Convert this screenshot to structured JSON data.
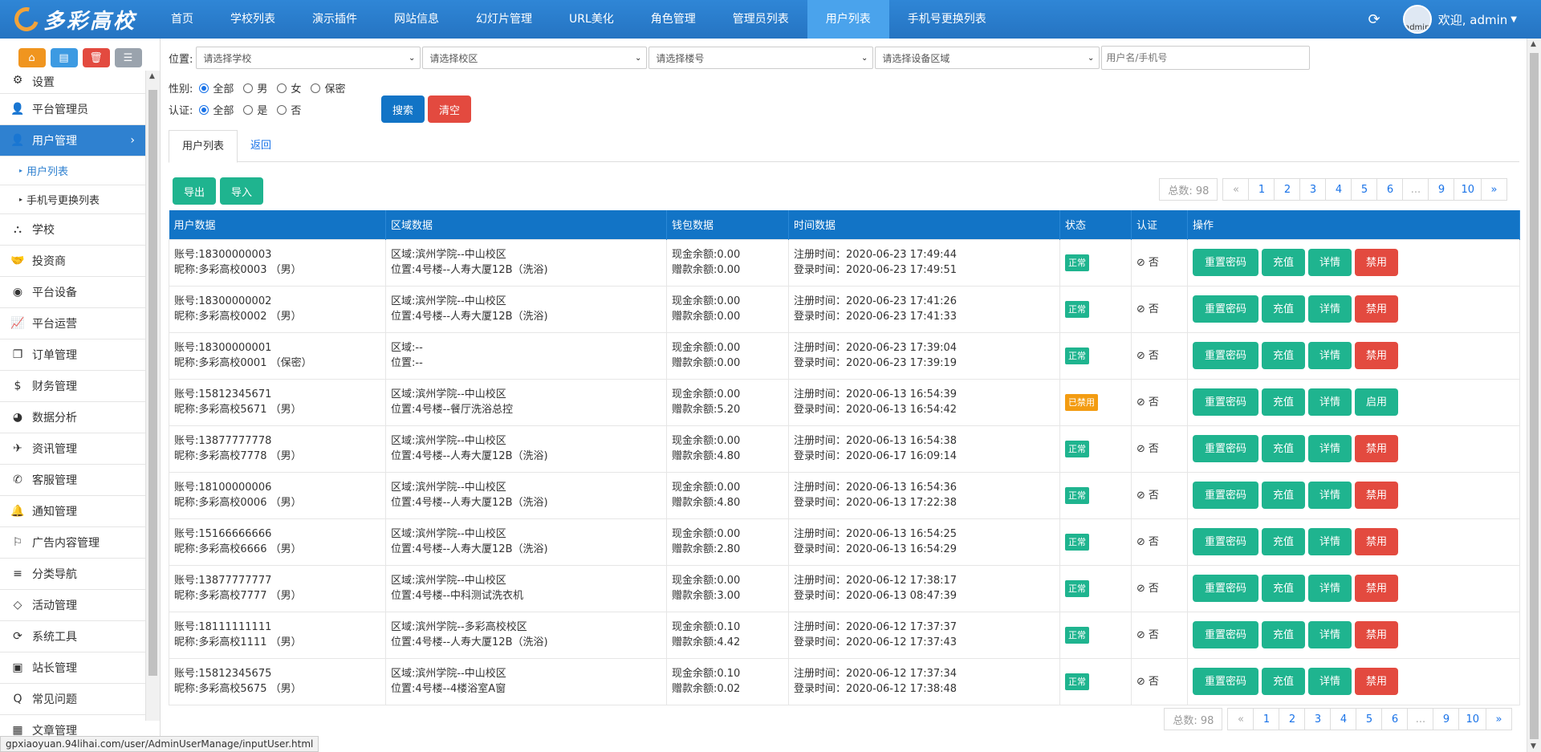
{
  "brand": {
    "name": "多彩高校"
  },
  "nav": [
    "首页",
    "学校列表",
    "演示插件",
    "网站信息",
    "幻灯片管理",
    "URL美化",
    "角色管理",
    "管理员列表",
    "用户列表",
    "手机号更换列表"
  ],
  "nav_active": 8,
  "user": {
    "avatar_alt": "admin",
    "greeting": "欢迎, admin"
  },
  "sidebar_tools": [
    {
      "icon": "home-icon",
      "glyph": "⌂",
      "color": "#f0951f"
    },
    {
      "icon": "file-icon",
      "glyph": "▤",
      "color": "#3c9ae2"
    },
    {
      "icon": "trash-icon",
      "glyph": "🗑",
      "color": "#e34a3f"
    },
    {
      "icon": "list-icon",
      "glyph": "☰",
      "color": "#9aa3ad"
    }
  ],
  "menu": [
    {
      "label": "设置",
      "icon": "gears-icon",
      "glyph": "⚙"
    },
    {
      "label": "平台管理员",
      "icon": "user-plus-icon",
      "glyph": "👤"
    },
    {
      "label": "用户管理",
      "icon": "user-icon",
      "glyph": "👤",
      "active": true
    },
    {
      "label": "用户列表",
      "sub": true,
      "active": true
    },
    {
      "label": "手机号更换列表",
      "sub": true
    },
    {
      "label": "学校",
      "icon": "sitemap-icon",
      "glyph": "⛬"
    },
    {
      "label": "投资商",
      "icon": "handshake-icon",
      "glyph": "🤝"
    },
    {
      "label": "平台设备",
      "icon": "broadcast-icon",
      "glyph": "◉"
    },
    {
      "label": "平台运营",
      "icon": "line-chart-icon",
      "glyph": "📈"
    },
    {
      "label": "订单管理",
      "icon": "copy-icon",
      "glyph": "❐"
    },
    {
      "label": "财务管理",
      "icon": "dollar-icon",
      "glyph": "$"
    },
    {
      "label": "数据分析",
      "icon": "pie-chart-icon",
      "glyph": "◕"
    },
    {
      "label": "资讯管理",
      "icon": "telegram-icon",
      "glyph": "✈"
    },
    {
      "label": "客服管理",
      "icon": "phone-volume-icon",
      "glyph": "✆"
    },
    {
      "label": "通知管理",
      "icon": "bell-icon",
      "glyph": "🔔"
    },
    {
      "label": "广告内容管理",
      "icon": "flag-icon",
      "glyph": "⚐"
    },
    {
      "label": "分类导航",
      "icon": "bars-icon",
      "glyph": "≡"
    },
    {
      "label": "活动管理",
      "icon": "diamond-icon",
      "glyph": "◇"
    },
    {
      "label": "系统工具",
      "icon": "refresh-icon",
      "glyph": "⟳"
    },
    {
      "label": "站长管理",
      "icon": "id-badge-icon",
      "glyph": "▣"
    },
    {
      "label": "常见问题",
      "icon": "q-icon",
      "glyph": "Q"
    },
    {
      "label": "文章管理",
      "icon": "grid-icon",
      "glyph": "▦"
    }
  ],
  "filters": {
    "position_label": "位置:",
    "school": "请选择学校",
    "campus": "请选择校区",
    "building": "请选择楼号",
    "area": "请选择设备区域",
    "search_placeholder": "用户名/手机号",
    "gender_label": "性别:",
    "gender_options": [
      "全部",
      "男",
      "女",
      "保密"
    ],
    "auth_label": "认证:",
    "auth_options": [
      "全部",
      "是",
      "否"
    ],
    "search_btn": "搜索",
    "clear_btn": "清空"
  },
  "tabs": [
    "用户列表",
    "返回"
  ],
  "actions": {
    "export": "导出",
    "import": "导入"
  },
  "pagination": {
    "total": "总数: 98",
    "prev": "«",
    "pages": [
      "1",
      "2",
      "3",
      "4",
      "5",
      "6",
      "...",
      "9",
      "10"
    ],
    "next": "»"
  },
  "table": {
    "headers": [
      "用户数据",
      "区域数据",
      "钱包数据",
      "时间数据",
      "状态",
      "认证",
      "操作"
    ],
    "rows": [
      {
        "account": "账号:18300000003",
        "nickname": "昵称:多彩高校0003 （男）",
        "area": "区域:滨州学院--中山校区",
        "pos": "位置:4号楼--人寿大厦12B（洗浴)",
        "cash": "现金余额:0.00",
        "gift": "赠款余额:0.00",
        "reg": "注册时间：2020-06-23 17:49:44",
        "login": "登录时间：2020-06-23 17:49:51",
        "status": "正常",
        "auth": "否",
        "toggle": "禁用"
      },
      {
        "account": "账号:18300000002",
        "nickname": "昵称:多彩高校0002 （男）",
        "area": "区域:滨州学院--中山校区",
        "pos": "位置:4号楼--人寿大厦12B（洗浴)",
        "cash": "现金余额:0.00",
        "gift": "赠款余额:0.00",
        "reg": "注册时间：2020-06-23 17:41:26",
        "login": "登录时间：2020-06-23 17:41:33",
        "status": "正常",
        "auth": "否",
        "toggle": "禁用"
      },
      {
        "account": "账号:18300000001",
        "nickname": "昵称:多彩高校0001 （保密）",
        "area": "区域:--",
        "pos": "位置:--",
        "cash": "现金余额:0.00",
        "gift": "赠款余额:0.00",
        "reg": "注册时间：2020-06-23 17:39:04",
        "login": "登录时间：2020-06-23 17:39:19",
        "status": "正常",
        "auth": "否",
        "toggle": "禁用"
      },
      {
        "account": "账号:15812345671",
        "nickname": "昵称:多彩高校5671 （男）",
        "area": "区域:滨州学院--中山校区",
        "pos": "位置:4号楼--餐厅洗浴总控",
        "cash": "现金余额:0.00",
        "gift": "赠款余额:5.20",
        "reg": "注册时间：2020-06-13 16:54:39",
        "login": "登录时间：2020-06-13 16:54:42",
        "status": "已禁用",
        "auth": "否",
        "toggle": "启用"
      },
      {
        "account": "账号:13877777778",
        "nickname": "昵称:多彩高校7778 （男）",
        "area": "区域:滨州学院--中山校区",
        "pos": "位置:4号楼--人寿大厦12B（洗浴)",
        "cash": "现金余额:0.00",
        "gift": "赠款余额:4.80",
        "reg": "注册时间：2020-06-13 16:54:38",
        "login": "登录时间：2020-06-17 16:09:14",
        "status": "正常",
        "auth": "否",
        "toggle": "禁用"
      },
      {
        "account": "账号:18100000006",
        "nickname": "昵称:多彩高校0006 （男）",
        "area": "区域:滨州学院--中山校区",
        "pos": "位置:4号楼--人寿大厦12B（洗浴)",
        "cash": "现金余额:0.00",
        "gift": "赠款余额:4.80",
        "reg": "注册时间：2020-06-13 16:54:36",
        "login": "登录时间：2020-06-13 17:22:38",
        "status": "正常",
        "auth": "否",
        "toggle": "禁用"
      },
      {
        "account": "账号:15166666666",
        "nickname": "昵称:多彩高校6666 （男）",
        "area": "区域:滨州学院--中山校区",
        "pos": "位置:4号楼--人寿大厦12B（洗浴)",
        "cash": "现金余额:0.00",
        "gift": "赠款余额:2.80",
        "reg": "注册时间：2020-06-13 16:54:25",
        "login": "登录时间：2020-06-13 16:54:29",
        "status": "正常",
        "auth": "否",
        "toggle": "禁用"
      },
      {
        "account": "账号:13877777777",
        "nickname": "昵称:多彩高校7777 （男）",
        "area": "区域:滨州学院--中山校区",
        "pos": "位置:4号楼--中科测试洗衣机",
        "cash": "现金余额:0.00",
        "gift": "赠款余额:3.00",
        "reg": "注册时间：2020-06-12 17:38:17",
        "login": "登录时间：2020-06-13 08:47:39",
        "status": "正常",
        "auth": "否",
        "toggle": "禁用"
      },
      {
        "account": "账号:18111111111",
        "nickname": "昵称:多彩高校1111 （男）",
        "area": "区域:滨州学院--多彩高校校区",
        "pos": "位置:4号楼--人寿大厦12B（洗浴)",
        "cash": "现金余额:0.10",
        "gift": "赠款余额:4.42",
        "reg": "注册时间：2020-06-12 17:37:37",
        "login": "登录时间：2020-06-12 17:37:43",
        "status": "正常",
        "auth": "否",
        "toggle": "禁用"
      },
      {
        "account": "账号:15812345675",
        "nickname": "昵称:多彩高校5675 （男）",
        "area": "区域:滨州学院--中山校区",
        "pos": "位置:4号楼--4楼浴室A窗",
        "cash": "现金余额:0.10",
        "gift": "赠款余额:0.02",
        "reg": "注册时间：2020-06-12 17:37:34",
        "login": "登录时间：2020-06-12 17:38:48",
        "status": "正常",
        "auth": "否",
        "toggle": "禁用"
      }
    ],
    "op_labels": {
      "reset": "重置密码",
      "charge": "充值",
      "detail": "详情"
    }
  },
  "statusbar": "gpxiaoyuan.94lihai.com/user/AdminUserManage/inputUser.html"
}
